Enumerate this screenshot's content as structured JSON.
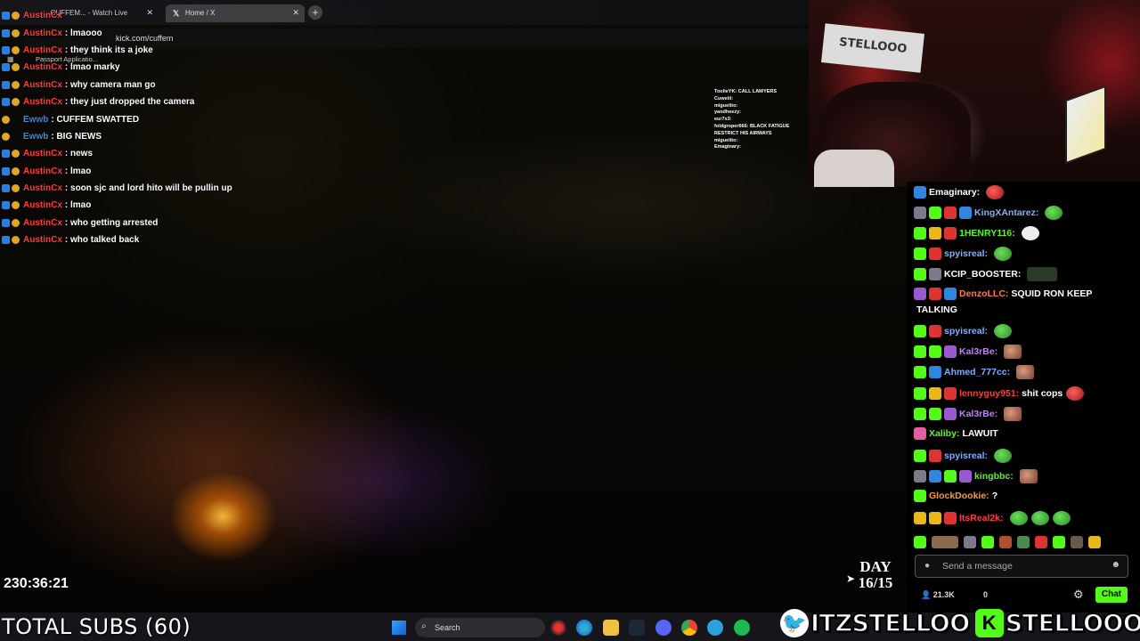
{
  "browser": {
    "tabs": [
      {
        "label": "...CUFFEM... - Watch Live"
      },
      {
        "label": "Home / X"
      }
    ],
    "new_tab": "+",
    "url": "kick.com/cuffem",
    "bookmark": "Passport Applicatio..."
  },
  "overlay_chat": {
    "rows": [
      {
        "name": "AustinCx",
        "msg": ""
      },
      {
        "name": "AustinCx",
        "msg": ": lmaooo"
      },
      {
        "name": "AustinCx",
        "msg": ": they think its a joke"
      },
      {
        "name": "AustinCx",
        "msg": ": lmao marky"
      },
      {
        "name": "AustinCx",
        "msg": ": why camera man go"
      },
      {
        "name": "AustinCx",
        "msg": ": they just dropped the camera"
      },
      {
        "name": "Ewwb",
        "msg": ":  CUFFEM SWATTED"
      },
      {
        "name": "Ewwb",
        "msg": ": BIG NEWS"
      },
      {
        "name": "AustinCx",
        "msg": ": news"
      },
      {
        "name": "AustinCx",
        "msg": ": lmao"
      },
      {
        "name": "AustinCx",
        "msg": ": soon sjc and lord hito will be pullin up"
      },
      {
        "name": "AustinCx",
        "msg": ": lmao"
      },
      {
        "name": "AustinCx",
        "msg": ": who getting arrested"
      },
      {
        "name": "AustinCx",
        "msg": ": who talked back"
      }
    ],
    "colors": {
      "austin": "#ff3b3b",
      "ewwb": "#2f8ee8"
    }
  },
  "mini_chat": [
    "ToolieYK: CALL LAWYERS",
    "Cuweiii:",
    "miguelito:",
    "yandheezy:",
    "eur7x3:",
    "foldgroper666: BLACK FATIGUE",
    "RESTRICT HIS AIRWAYS",
    "miguelito:",
    "Emaginary:"
  ],
  "webcam": {
    "sign_text": "STELLOOO"
  },
  "right_chat": {
    "rows": [
      {
        "name": "Emaginary:",
        "color": "#ffffff",
        "msg": ""
      },
      {
        "name": "KingXAntarez:",
        "color": "#7fb0ff",
        "msg": ""
      },
      {
        "name": "1HENRY116:",
        "color": "#53fc18",
        "msg": ""
      },
      {
        "name": "spyisreal:",
        "color": "#7fb0ff",
        "msg": ""
      },
      {
        "name": "KCIP_BOOSTER:",
        "color": "#ffffff",
        "msg": ""
      },
      {
        "name": "DenzoLLC:",
        "color": "#ff7a4a",
        "msg": "SQUID RON KEEP"
      },
      {
        "name": "",
        "color": "#ffffff",
        "msg": "TALKING"
      },
      {
        "name": "spyisreal:",
        "color": "#7fb0ff",
        "msg": ""
      },
      {
        "name": "Kal3rBe:",
        "color": "#c27dff",
        "msg": ""
      },
      {
        "name": "Ahmed_777cc:",
        "color": "#7fb0ff",
        "msg": ""
      },
      {
        "name": "lennyguy951:",
        "color": "#ff3b3b",
        "msg": "shit cops"
      },
      {
        "name": "Kal3rBe:",
        "color": "#c27dff",
        "msg": ""
      },
      {
        "name": "Xaliby:",
        "color": "#53fc18",
        "msg": "LAWUIT"
      },
      {
        "name": "spyisreal:",
        "color": "#7fb0ff",
        "msg": ""
      },
      {
        "name": "kingbbc:",
        "color": "#53fc18",
        "msg": ""
      },
      {
        "name": "GlockDookie:",
        "color": "#ff9a30",
        "msg": "?"
      },
      {
        "name": "ItsReal2k:",
        "color": "#ff3b3b",
        "msg": ""
      }
    ],
    "input_placeholder": "Send a message",
    "viewers": "21.3K",
    "zero": "0",
    "chat_button": "Chat"
  },
  "stream": {
    "timer": "230:36:21",
    "day": "DAY",
    "day_count": "16/15",
    "total_subs": "TOTAL SUBS (60)"
  },
  "taskbar": {
    "search": "Search"
  },
  "socials": {
    "twitter_handle": "ITZSTELLOO",
    "kick_handle": "STELLOOO"
  }
}
